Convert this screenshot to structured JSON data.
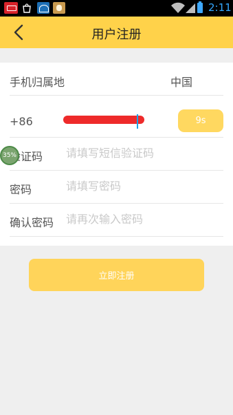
{
  "status_bar": {
    "time": "2:11"
  },
  "header": {
    "title": "用户注册",
    "back_icon": "chevron-left-icon"
  },
  "form": {
    "country": {
      "label": "手机归属地",
      "value": "中国"
    },
    "phone": {
      "prefix": "+86",
      "value": "",
      "countdown_label": "9s"
    },
    "verify_code": {
      "label": "验证码",
      "placeholder": "请填写短信验证码"
    },
    "password": {
      "label": "密码",
      "placeholder": "请填写密码"
    },
    "confirm_password": {
      "label": "确认密码",
      "placeholder": "请再次输入密码"
    }
  },
  "floating_widget": {
    "label": "35%"
  },
  "submit": {
    "label": "立即注册"
  },
  "colors": {
    "accent": "#ffd24a",
    "button": "#ffd45a",
    "cursor": "#1aa3e8",
    "redaction": "#ee2a2a"
  }
}
